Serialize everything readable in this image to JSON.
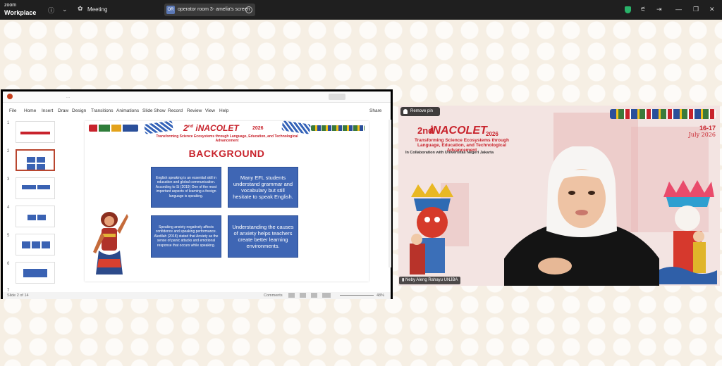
{
  "titlebar": {
    "app_name_small": "zoom",
    "app_name": "Workplace",
    "meeting_label": "Meeting",
    "share_avatar": "OR",
    "share_text": "operator room 3- amelia's screen"
  },
  "ppt": {
    "doc_title": "...",
    "menu": [
      "File",
      "Home",
      "Insert",
      "Draw",
      "Design",
      "Transitions",
      "Animations",
      "Slide Show",
      "Record",
      "Review",
      "View",
      "Help"
    ],
    "share_label": "Share",
    "thumbnail_numbers": [
      "1",
      "2",
      "3",
      "4",
      "5",
      "6",
      "7"
    ],
    "status_left": "Slide 2 of 14",
    "status_comments": "Comments",
    "zoom": "48%"
  },
  "slide": {
    "conf_prefix": "2",
    "conf_ordinal": "nd",
    "conf_name": "iNACOLET",
    "conf_year": "2026",
    "theme": "Transforming Science Ecosystems through Language, Education, and Technological Advancement",
    "heading": "BACKGROUND",
    "box1": "English speaking is an essential skill in education and global communication. According to Si (2019) One of the most important aspects of learning a foreign language is speaking.",
    "box2": "Many EFL students understand grammar and vocabulary but still hesitate to speak English.",
    "box3": "Speaking anxiety negatively affects confidence and speaking performance. Aledilah (2018) stated that Anxiety as the sense of panic attacks and emotional response that occurs while speaking.",
    "box4": "Understanding the causes of anxiety helps teachers create better learning environments."
  },
  "video": {
    "remove_pin": "Remove pin",
    "conf_nd": "2nd",
    "conf_name": "iNACOLET",
    "conf_year": "2026",
    "theme": "Transforming Science Ecosystems through Language, Education, and Technological Advancement",
    "collab": "In Collaboration with Universitas Negeri Jakarta",
    "date_range": "16-17",
    "date_month": "July 2026",
    "participant_name": "Neby Aleng Rahayu UNJBA"
  },
  "colors": {
    "accent": "#c8232c",
    "box_blue": "#3f66b4",
    "zoom_bar": "#1f1f1f"
  }
}
